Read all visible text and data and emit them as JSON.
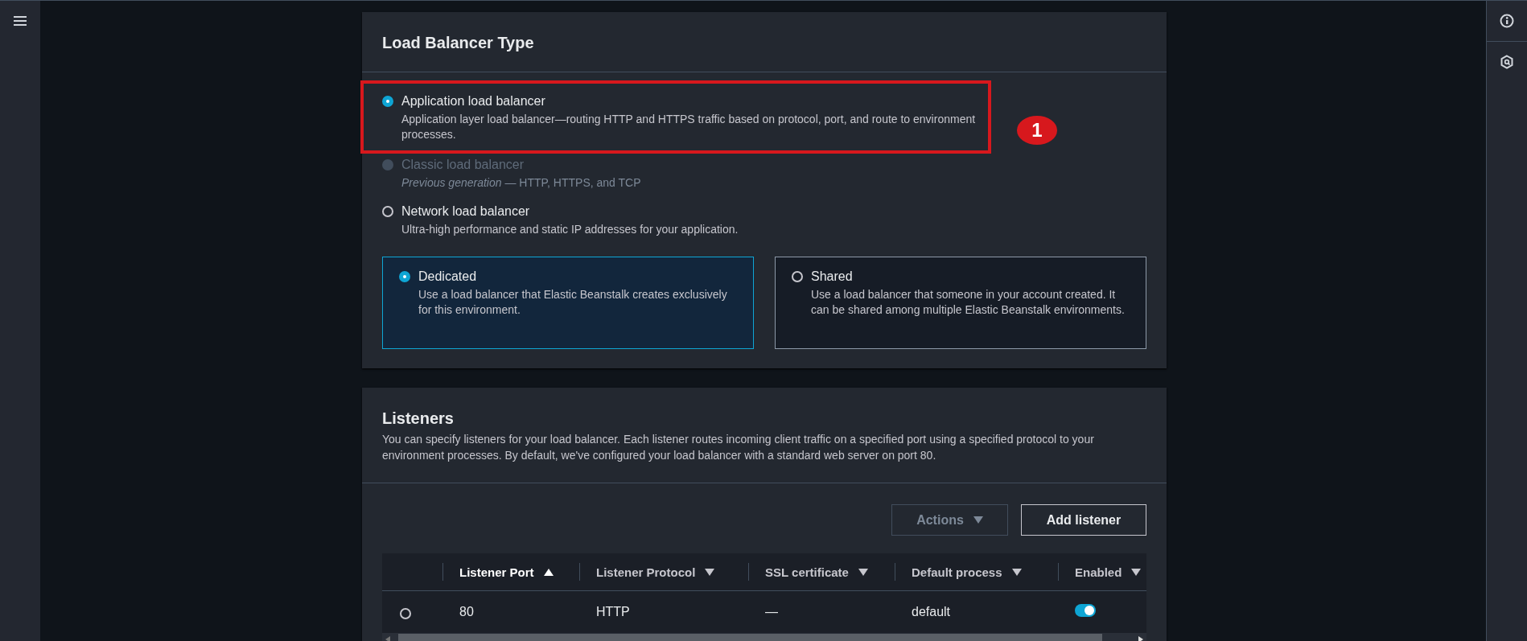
{
  "load_balancer_type": {
    "title": "Load Balancer Type",
    "options": [
      {
        "label": "Application load balancer",
        "description": "Application layer load balancer—routing HTTP and HTTPS traffic based on protocol, port, and route to environment processes.",
        "selected": true,
        "disabled": false,
        "highlighted": true,
        "callout": "1"
      },
      {
        "label": "Classic load balancer",
        "description": "*Previous generation* — HTTP, HTTPS, and TCP",
        "selected": false,
        "disabled": true,
        "highlighted": false
      },
      {
        "label": "Network load balancer",
        "description": "Ultra-high performance and static IP addresses for your application.",
        "selected": false,
        "disabled": false,
        "highlighted": false
      }
    ],
    "tiles": [
      {
        "label": "Dedicated",
        "description": "Use a load balancer that Elastic Beanstalk creates exclusively for this environment.",
        "selected": true
      },
      {
        "label": "Shared",
        "description": "Use a load balancer that someone in your account created. It can be shared among multiple Elastic Beanstalk environments.",
        "selected": false
      }
    ]
  },
  "listeners": {
    "title": "Listeners",
    "description": "You can specify listeners for your load balancer. Each listener routes incoming client traffic on a specified port using a specified protocol to your environment processes. By default, we've configured your load balancer with a standard web server on port 80.",
    "buttons": [
      {
        "label": "Actions",
        "disabled": true,
        "dropdown": true
      },
      {
        "label": "Add listener",
        "disabled": false,
        "dropdown": false
      }
    ],
    "table": {
      "columns": [
        {
          "label": "Listener Port",
          "sorted": true
        },
        {
          "label": "Listener Protocol",
          "sorted": false
        },
        {
          "label": "SSL certificate",
          "sorted": false
        },
        {
          "label": "Default process",
          "sorted": false
        },
        {
          "label": "Enabled",
          "sorted": false
        }
      ],
      "rows": [
        {
          "selected": false,
          "port": "80",
          "protocol": "HTTP",
          "certificate": "—",
          "process": "default",
          "enabled": true
        }
      ]
    }
  }
}
